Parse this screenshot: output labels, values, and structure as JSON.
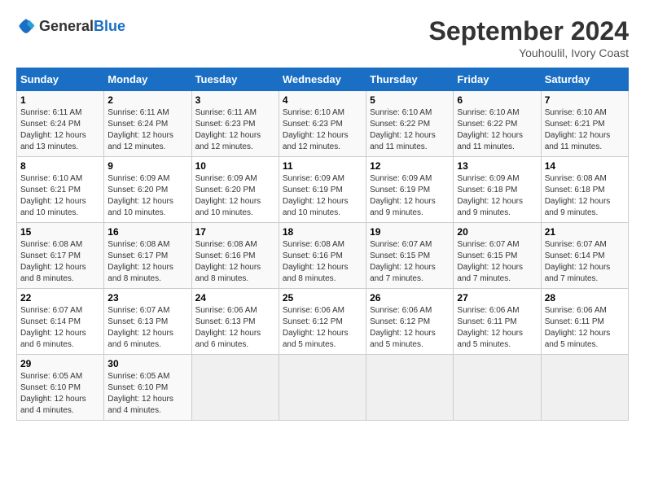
{
  "logo": {
    "text_general": "General",
    "text_blue": "Blue"
  },
  "title": {
    "month_year": "September 2024",
    "location": "Youhoulil, Ivory Coast"
  },
  "weekdays": [
    "Sunday",
    "Monday",
    "Tuesday",
    "Wednesday",
    "Thursday",
    "Friday",
    "Saturday"
  ],
  "weeks": [
    [
      {
        "day": "1",
        "sunrise": "6:11 AM",
        "sunset": "6:24 PM",
        "daylight": "12 hours and 13 minutes."
      },
      {
        "day": "2",
        "sunrise": "6:11 AM",
        "sunset": "6:24 PM",
        "daylight": "12 hours and 12 minutes."
      },
      {
        "day": "3",
        "sunrise": "6:11 AM",
        "sunset": "6:23 PM",
        "daylight": "12 hours and 12 minutes."
      },
      {
        "day": "4",
        "sunrise": "6:10 AM",
        "sunset": "6:23 PM",
        "daylight": "12 hours and 12 minutes."
      },
      {
        "day": "5",
        "sunrise": "6:10 AM",
        "sunset": "6:22 PM",
        "daylight": "12 hours and 11 minutes."
      },
      {
        "day": "6",
        "sunrise": "6:10 AM",
        "sunset": "6:22 PM",
        "daylight": "12 hours and 11 minutes."
      },
      {
        "day": "7",
        "sunrise": "6:10 AM",
        "sunset": "6:21 PM",
        "daylight": "12 hours and 11 minutes."
      }
    ],
    [
      {
        "day": "8",
        "sunrise": "6:10 AM",
        "sunset": "6:21 PM",
        "daylight": "12 hours and 10 minutes."
      },
      {
        "day": "9",
        "sunrise": "6:09 AM",
        "sunset": "6:20 PM",
        "daylight": "12 hours and 10 minutes."
      },
      {
        "day": "10",
        "sunrise": "6:09 AM",
        "sunset": "6:20 PM",
        "daylight": "12 hours and 10 minutes."
      },
      {
        "day": "11",
        "sunrise": "6:09 AM",
        "sunset": "6:19 PM",
        "daylight": "12 hours and 10 minutes."
      },
      {
        "day": "12",
        "sunrise": "6:09 AM",
        "sunset": "6:19 PM",
        "daylight": "12 hours and 9 minutes."
      },
      {
        "day": "13",
        "sunrise": "6:09 AM",
        "sunset": "6:18 PM",
        "daylight": "12 hours and 9 minutes."
      },
      {
        "day": "14",
        "sunrise": "6:08 AM",
        "sunset": "6:18 PM",
        "daylight": "12 hours and 9 minutes."
      }
    ],
    [
      {
        "day": "15",
        "sunrise": "6:08 AM",
        "sunset": "6:17 PM",
        "daylight": "12 hours and 8 minutes."
      },
      {
        "day": "16",
        "sunrise": "6:08 AM",
        "sunset": "6:17 PM",
        "daylight": "12 hours and 8 minutes."
      },
      {
        "day": "17",
        "sunrise": "6:08 AM",
        "sunset": "6:16 PM",
        "daylight": "12 hours and 8 minutes."
      },
      {
        "day": "18",
        "sunrise": "6:08 AM",
        "sunset": "6:16 PM",
        "daylight": "12 hours and 8 minutes."
      },
      {
        "day": "19",
        "sunrise": "6:07 AM",
        "sunset": "6:15 PM",
        "daylight": "12 hours and 7 minutes."
      },
      {
        "day": "20",
        "sunrise": "6:07 AM",
        "sunset": "6:15 PM",
        "daylight": "12 hours and 7 minutes."
      },
      {
        "day": "21",
        "sunrise": "6:07 AM",
        "sunset": "6:14 PM",
        "daylight": "12 hours and 7 minutes."
      }
    ],
    [
      {
        "day": "22",
        "sunrise": "6:07 AM",
        "sunset": "6:14 PM",
        "daylight": "12 hours and 6 minutes."
      },
      {
        "day": "23",
        "sunrise": "6:07 AM",
        "sunset": "6:13 PM",
        "daylight": "12 hours and 6 minutes."
      },
      {
        "day": "24",
        "sunrise": "6:06 AM",
        "sunset": "6:13 PM",
        "daylight": "12 hours and 6 minutes."
      },
      {
        "day": "25",
        "sunrise": "6:06 AM",
        "sunset": "6:12 PM",
        "daylight": "12 hours and 5 minutes."
      },
      {
        "day": "26",
        "sunrise": "6:06 AM",
        "sunset": "6:12 PM",
        "daylight": "12 hours and 5 minutes."
      },
      {
        "day": "27",
        "sunrise": "6:06 AM",
        "sunset": "6:11 PM",
        "daylight": "12 hours and 5 minutes."
      },
      {
        "day": "28",
        "sunrise": "6:06 AM",
        "sunset": "6:11 PM",
        "daylight": "12 hours and 5 minutes."
      }
    ],
    [
      {
        "day": "29",
        "sunrise": "6:05 AM",
        "sunset": "6:10 PM",
        "daylight": "12 hours and 4 minutes."
      },
      {
        "day": "30",
        "sunrise": "6:05 AM",
        "sunset": "6:10 PM",
        "daylight": "12 hours and 4 minutes."
      },
      null,
      null,
      null,
      null,
      null
    ]
  ]
}
